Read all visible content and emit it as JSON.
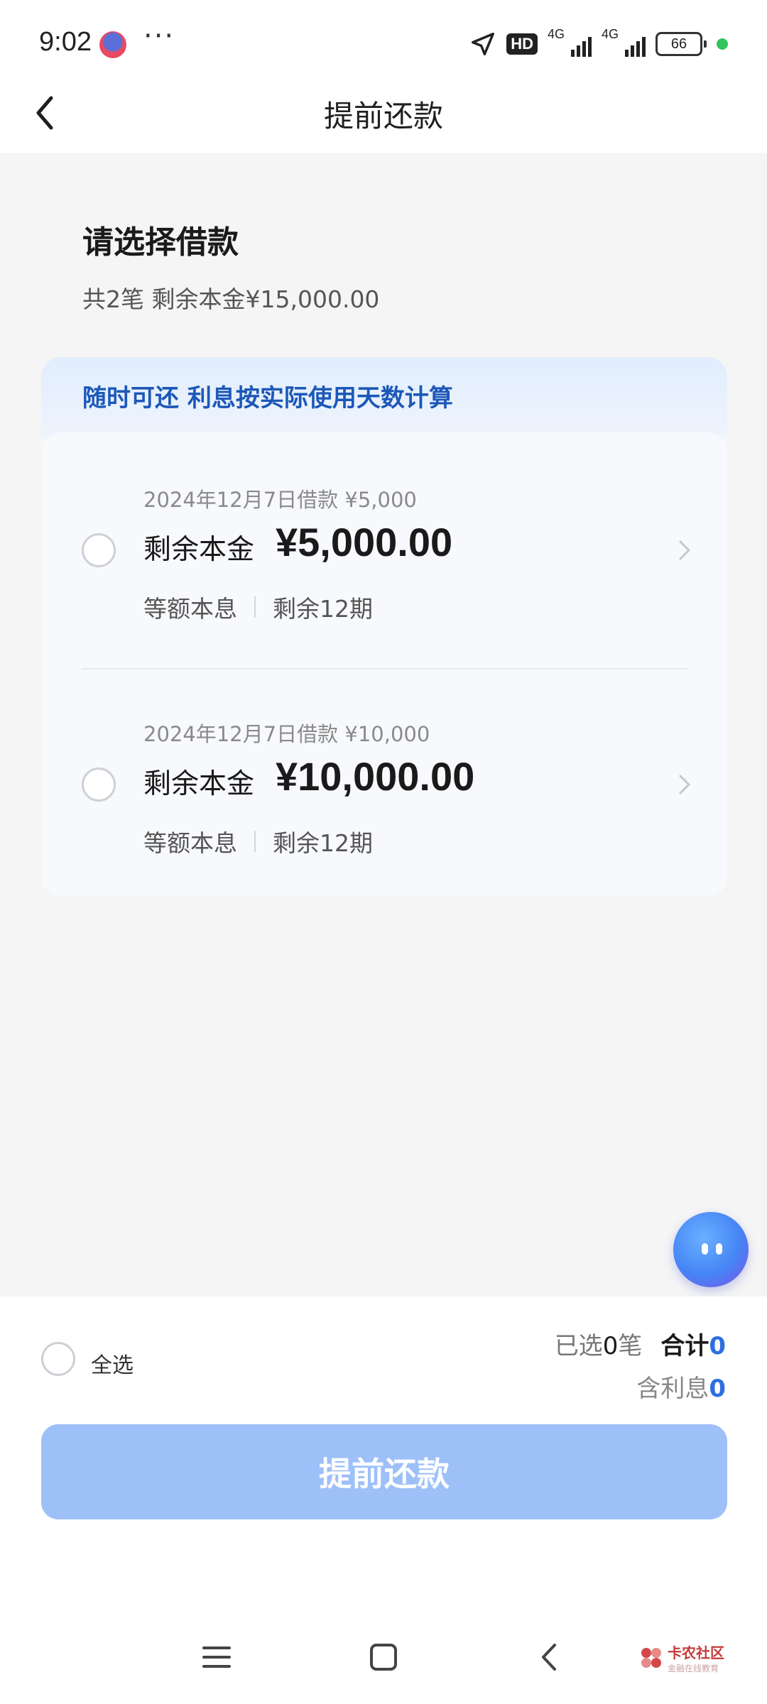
{
  "status_bar": {
    "time": "9:02",
    "more": "···",
    "hd_badge": "HD",
    "network_1": "4G",
    "network_2": "4G",
    "battery": "66",
    "icons": [
      "app-notification-icon",
      "location-arrow-icon",
      "signal-icon",
      "battery-icon"
    ]
  },
  "header": {
    "title": "提前还款",
    "back_icon": "chevron-left-icon"
  },
  "summary": {
    "title": "请选择借款",
    "subtitle": "共2笔 剩余本金¥15,000.00"
  },
  "card": {
    "banner": "随时可还 利息按实际使用天数计算",
    "loans": [
      {
        "date_amount": "2024年12月7日借款 ¥5,000",
        "principal_label": "剩余本金",
        "principal_amount": "¥5,000.00",
        "method": "等额本息",
        "remaining": "剩余12期"
      },
      {
        "date_amount": "2024年12月7日借款 ¥10,000",
        "principal_label": "剩余本金",
        "principal_amount": "¥10,000.00",
        "method": "等额本息",
        "remaining": "剩余12期"
      }
    ]
  },
  "footer": {
    "select_all": "全选",
    "selected_prefix": "已选",
    "selected_count": "0",
    "selected_suffix": "笔",
    "total_label": "合计",
    "total_value": "0",
    "interest_label": "含利息",
    "interest_value": "0",
    "button": "提前还款"
  },
  "watermark": {
    "line1": "卡农社区",
    "line2": "金融在线教育"
  },
  "colors": {
    "accent": "#2d6fe0",
    "button_disabled": "#9ec0f9",
    "banner_text": "#1c58b8"
  }
}
